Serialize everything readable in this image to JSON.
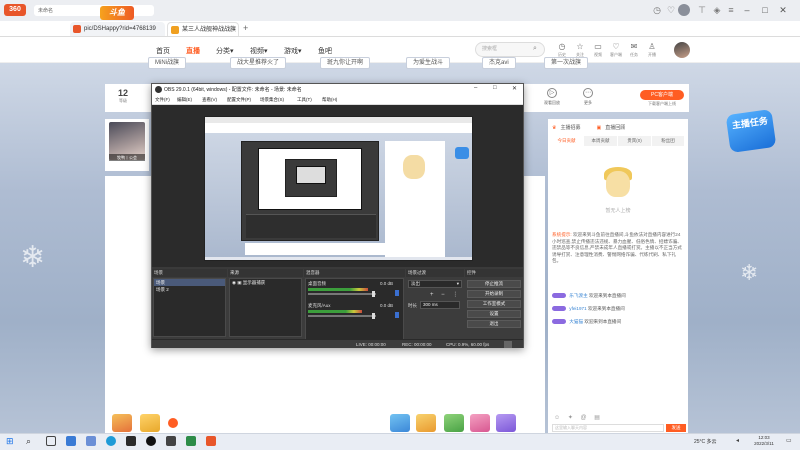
{
  "browser": {
    "active_tab_label": "未命名",
    "tabs": [
      {
        "label": "pic/DSHappy?rid=4768139",
        "active": false
      },
      {
        "label": "某三人战舰神战战旗",
        "active": true
      }
    ],
    "new_tab": "+"
  },
  "site": {
    "logo_text": "斗鱼",
    "nav": [
      "首页",
      "直播",
      "分类▾",
      "视频▾",
      "游戏▾",
      "鱼吧"
    ],
    "search_placeholder": "搜索框",
    "header_icons": [
      {
        "icon": "clock-icon",
        "label": "历史"
      },
      {
        "icon": "star-icon",
        "label": "关注"
      },
      {
        "icon": "video-icon",
        "label": "视频"
      },
      {
        "icon": "chat-icon",
        "label": "客户端"
      },
      {
        "icon": "gift-icon",
        "label": "任务"
      },
      {
        "icon": "pin-icon",
        "label": "开播"
      }
    ]
  },
  "tags": [
    "MiNi战旗",
    "战大星推荐火了",
    "斑九你让开啊",
    "为爱生战斗",
    "杰克avi",
    "第一次战旗"
  ],
  "room": {
    "level": "12",
    "level_label": "等级",
    "icons": [
      {
        "icon": "replay-icon",
        "label": "观看回放"
      },
      {
        "icon": "more-icon",
        "label": "更多"
      }
    ],
    "pc_button": "PC客户端",
    "pc_sub": "下载客户端上线"
  },
  "anchor": {
    "label": "牧鸭丨公会"
  },
  "obs": {
    "title": "OBS 29.0.1 (64bit, windows) - 配置文件: 未命名 - 场景: 未命名",
    "menu": [
      "文件(F)",
      "编辑(E)",
      "查看(V)",
      "配置文件(P)",
      "场景集合(S)",
      "工具(T)",
      "帮助(H)"
    ],
    "docks": {
      "scenes": {
        "title": "场景",
        "items": [
          "场景",
          "场景 2"
        ]
      },
      "sources": {
        "title": "来源",
        "items": [
          "显示器捕获"
        ]
      },
      "mixer": {
        "title": "混音器",
        "channels": [
          {
            "name": "桌面音频",
            "db": "0.0 dB",
            "level": 0.75
          },
          {
            "name": "麦克风/Aux",
            "db": "0.0 dB",
            "level": 0.68
          }
        ]
      },
      "transitions": {
        "title": "场景过渡",
        "type": "淡出",
        "duration_label": "时长",
        "duration": "300 ms"
      },
      "controls": {
        "title": "控件",
        "buttons": [
          "停止推流",
          "开始录制",
          "工作室模式",
          "设置",
          "退出"
        ]
      }
    },
    "status": {
      "live": "LIVE: 00:00:00",
      "rec": "REC: 00:00:00",
      "cpu": "CPU: 0.9%, 60.00 fps"
    }
  },
  "chat": {
    "rank_tabs": [
      "主播招募",
      "直播回顾"
    ],
    "sub_tabs": [
      "今日贡献",
      "本周贡献",
      "贵宾(0)",
      "粉丝团"
    ],
    "mascot_caption": "暂无人上榜",
    "system_prefix": "系统提示:",
    "system_msg": "欢迎来到斗鱼前往直播间,斗鱼依法对直播内容进行24小时巡查,禁止传播违法违规、暴力血腥、低俗色情、招嫖诈骗、违禁品等不良信息,严禁未成年人直播或打赏。主播以不正当方式诱导打赏、注意理性消费、警惕网络诈骗、代练代刷、私下礼包。",
    "lines": [
      {
        "badge": true,
        "name": "乐飞渡主",
        "text": "欢迎来到本直播间"
      },
      {
        "badge": true,
        "name": "yfei1971",
        "text": "欢迎来到本直播间"
      },
      {
        "badge": true,
        "name": "大猫猫",
        "text": "欢迎来到本直播间"
      }
    ],
    "input_placeholder": "这里输入聊天内容",
    "send": "发送"
  },
  "side": {
    "task_badge": "主播任务"
  },
  "taskbar": {
    "temperature": "25°C 多云",
    "time": "12:03",
    "date": "2022/3/11"
  },
  "colors": {
    "accent": "#ff5d23",
    "obs_bg": "#3a3a3a"
  }
}
